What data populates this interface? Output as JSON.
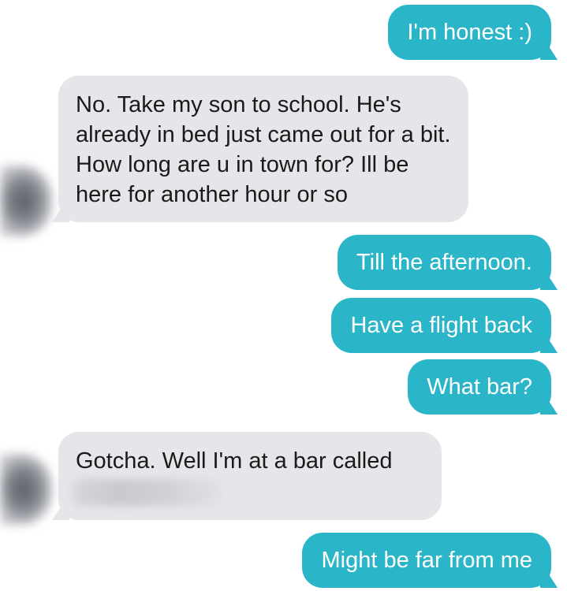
{
  "messages": [
    {
      "direction": "sent",
      "text": "I'm honest :)"
    },
    {
      "direction": "received",
      "text": "No. Take my son to school. He's already in bed just came out for a bit. How long are u in town for? Ill be here for another hour or so"
    },
    {
      "direction": "sent",
      "text": "Till the afternoon."
    },
    {
      "direction": "sent",
      "text": "Have a flight back"
    },
    {
      "direction": "sent",
      "text": "What bar?"
    },
    {
      "direction": "received",
      "text": "Gotcha. Well I'm at a bar called",
      "redacted_continuation": true
    },
    {
      "direction": "sent",
      "text": "Might be far from me"
    }
  ],
  "colors": {
    "sent_bubble": "#2bb5c9",
    "received_bubble": "#e6e6ea",
    "sent_text": "#ffffff",
    "received_text": "#1a1a1a"
  }
}
